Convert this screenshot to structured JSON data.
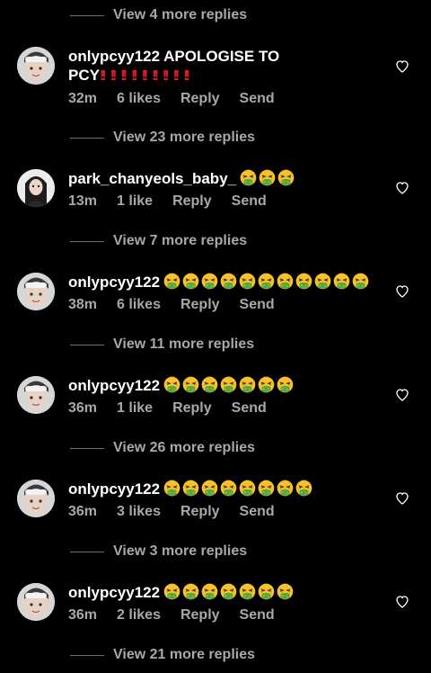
{
  "colors": {
    "background": "#000000",
    "secondary_text": "#a8a8a8",
    "exclamation": "#e21d2a",
    "emoji_face": "#f6c12c",
    "emoji_green": "#59a83a"
  },
  "icons": {
    "heart": "heart-outline-icon",
    "emoji": "vomiting-face-emoji",
    "exclamation": "double-exclamation-mark"
  },
  "reply_threads": [
    {
      "label": "View 4 more replies"
    },
    {
      "label": "View 23 more replies"
    },
    {
      "label": "View 7 more replies"
    },
    {
      "label": "View 11 more replies"
    },
    {
      "label": "View 26 more replies"
    },
    {
      "label": "View 3 more replies"
    },
    {
      "label": "View 21 more replies"
    }
  ],
  "comments": [
    {
      "username": "onlypcyy122",
      "text_line1": "APOLOGISE TO",
      "text_line2": "PCY",
      "exclamation_count": 9,
      "emoji_count": 0,
      "time": "32m",
      "likes": "6 likes",
      "reply": "Reply",
      "send": "Send"
    },
    {
      "username": "park_chanyeols_baby_",
      "text_line1": "",
      "text_line2": "",
      "exclamation_count": 0,
      "emoji_count": 3,
      "time": "13m",
      "likes": "1 like",
      "reply": "Reply",
      "send": "Send"
    },
    {
      "username": "onlypcyy122",
      "text_line1": "",
      "text_line2": "",
      "exclamation_count": 0,
      "emoji_count": 11,
      "time": "38m",
      "likes": "6 likes",
      "reply": "Reply",
      "send": "Send"
    },
    {
      "username": "onlypcyy122",
      "text_line1": "",
      "text_line2": "",
      "exclamation_count": 0,
      "emoji_count": 7,
      "time": "36m",
      "likes": "1 like",
      "reply": "Reply",
      "send": "Send"
    },
    {
      "username": "onlypcyy122",
      "text_line1": "",
      "text_line2": "",
      "exclamation_count": 0,
      "emoji_count": 8,
      "time": "36m",
      "likes": "3 likes",
      "reply": "Reply",
      "send": "Send"
    },
    {
      "username": "onlypcyy122",
      "text_line1": "",
      "text_line2": "",
      "exclamation_count": 0,
      "emoji_count": 7,
      "time": "36m",
      "likes": "2 likes",
      "reply": "Reply",
      "send": "Send"
    }
  ]
}
